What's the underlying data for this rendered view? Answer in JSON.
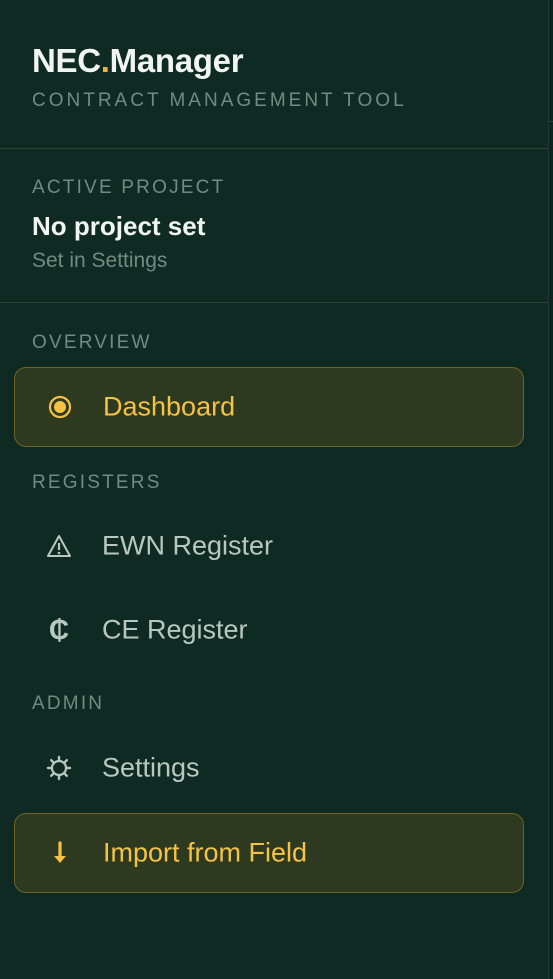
{
  "app": {
    "name_part1": "NEC",
    "name_dot": ".",
    "name_part2": "Manager",
    "tagline": "CONTRACT MANAGEMENT TOOL"
  },
  "project": {
    "section_label": "ACTIVE PROJECT",
    "name": "No project set",
    "hint": "Set in Settings"
  },
  "nav": {
    "overview_label": "OVERVIEW",
    "registers_label": "REGISTERS",
    "admin_label": "ADMIN",
    "items": [
      {
        "label": "Dashboard",
        "icon": "target-icon"
      },
      {
        "label": "EWN Register",
        "icon": "warning-icon"
      },
      {
        "label": "CE Register",
        "icon": "cedi-icon"
      },
      {
        "label": "Settings",
        "icon": "gear-icon"
      },
      {
        "label": "Import from Field",
        "icon": "download-arrow-icon"
      }
    ]
  },
  "colors": {
    "background": "#0f2a22",
    "accent": "#f5c243",
    "active_bg": "#2e3a20",
    "active_border": "#6e6424",
    "muted": "#6f8c82"
  }
}
